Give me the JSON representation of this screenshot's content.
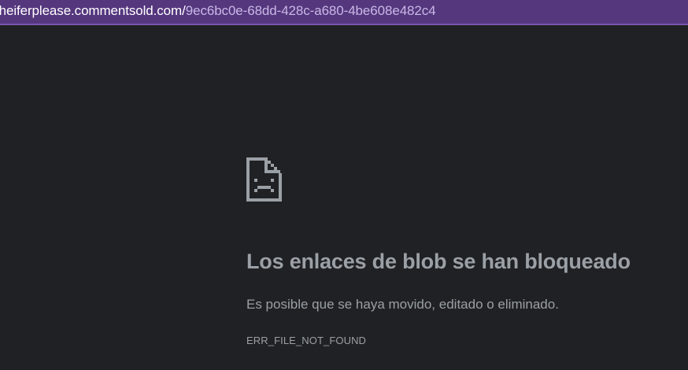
{
  "address_bar": {
    "url_host": "/heiferplease.commentsold.com/",
    "url_path": "9ec6bc0e-68dd-428c-a680-4be608e482c4"
  },
  "error": {
    "icon": "sad-file-icon",
    "title": "Los enlaces de blob se han bloqueado",
    "description": "Es posible que se haya movido, editado o eliminado.",
    "code": "ERR_FILE_NOT_FOUND"
  },
  "colors": {
    "page_background": "#202124",
    "url_bar_background": "#55377e",
    "text_gray": "#9aa0a6"
  }
}
